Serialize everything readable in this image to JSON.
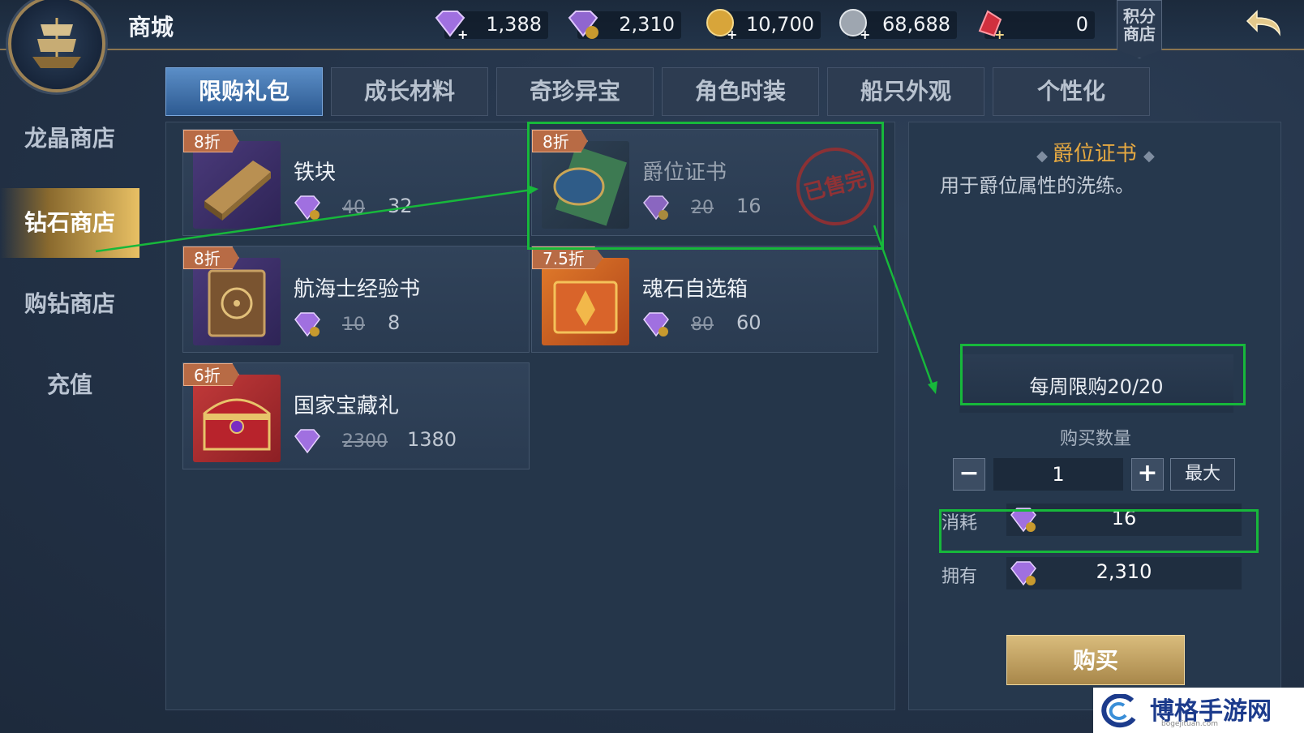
{
  "header": {
    "title": "商城",
    "points_shop": "积分\n商店",
    "points_shop_l1": "积分",
    "points_shop_l2": "商店"
  },
  "currencies": [
    {
      "icon": "purple-diamond-icon",
      "value": "1,388"
    },
    {
      "icon": "bound-diamond-icon",
      "value": "2,310"
    },
    {
      "icon": "gold-coin-icon",
      "value": "10,700"
    },
    {
      "icon": "silver-coin-icon",
      "value": "68,688"
    },
    {
      "icon": "red-crystal-icon",
      "value": "0"
    }
  ],
  "sidebar": {
    "items": [
      {
        "label": "龙晶商店",
        "active": false
      },
      {
        "label": "钻石商店",
        "active": true
      },
      {
        "label": "购钻商店",
        "active": false
      },
      {
        "label": "充值",
        "active": false
      }
    ]
  },
  "tabs": [
    {
      "label": "限购礼包",
      "active": true
    },
    {
      "label": "成长材料",
      "active": false
    },
    {
      "label": "奇珍异宝",
      "active": false
    },
    {
      "label": "角色时装",
      "active": false
    },
    {
      "label": "船只外观",
      "active": false
    },
    {
      "label": "个性化",
      "active": false
    }
  ],
  "products": [
    {
      "name": "铁块",
      "discount": "8折",
      "old_price": "40",
      "price": "32",
      "sold_out": false,
      "icon": "iron-ingot-icon"
    },
    {
      "name": "爵位证书",
      "discount": "8折",
      "old_price": "20",
      "price": "16",
      "sold_out": true,
      "sold_label": "已售完",
      "icon": "certificate-icon"
    },
    {
      "name": "航海士经验书",
      "discount": "8折",
      "old_price": "10",
      "price": "8",
      "sold_out": false,
      "icon": "book-icon"
    },
    {
      "name": "魂石自选箱",
      "discount": "7.5折",
      "old_price": "80",
      "price": "60",
      "sold_out": false,
      "icon": "chest-icon"
    },
    {
      "name": "国家宝藏礼",
      "discount": "6折",
      "old_price": "2300",
      "price": "1380",
      "sold_out": false,
      "icon": "treasure-chest-icon"
    }
  ],
  "detail": {
    "title": "爵位证书",
    "description": "用于爵位属性的洗练。",
    "weekly_limit": "每周限购20/20",
    "quantity_label": "购买数量",
    "quantity": "1",
    "max_label": "最大",
    "cost_label": "消耗",
    "cost": "16",
    "own_label": "拥有",
    "own": "2,310",
    "buy_label": "购买"
  },
  "watermark": {
    "text": "博格手游网",
    "sub": "bogejituan.com"
  },
  "colors": {
    "accent_gold": "#e6a941",
    "highlight_green": "#17b83b",
    "active_tab": "#3e73b0"
  }
}
